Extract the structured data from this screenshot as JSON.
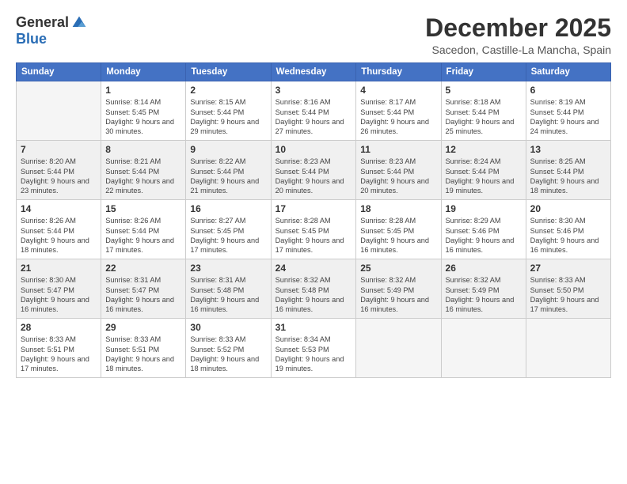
{
  "logo": {
    "general": "General",
    "blue": "Blue"
  },
  "title": "December 2025",
  "location": "Sacedon, Castille-La Mancha, Spain",
  "days_of_week": [
    "Sunday",
    "Monday",
    "Tuesday",
    "Wednesday",
    "Thursday",
    "Friday",
    "Saturday"
  ],
  "weeks": [
    [
      {
        "day": "",
        "sunrise": "",
        "sunset": "",
        "daylight": "",
        "empty": true
      },
      {
        "day": "1",
        "sunrise": "Sunrise: 8:14 AM",
        "sunset": "Sunset: 5:45 PM",
        "daylight": "Daylight: 9 hours and 30 minutes."
      },
      {
        "day": "2",
        "sunrise": "Sunrise: 8:15 AM",
        "sunset": "Sunset: 5:44 PM",
        "daylight": "Daylight: 9 hours and 29 minutes."
      },
      {
        "day": "3",
        "sunrise": "Sunrise: 8:16 AM",
        "sunset": "Sunset: 5:44 PM",
        "daylight": "Daylight: 9 hours and 27 minutes."
      },
      {
        "day": "4",
        "sunrise": "Sunrise: 8:17 AM",
        "sunset": "Sunset: 5:44 PM",
        "daylight": "Daylight: 9 hours and 26 minutes."
      },
      {
        "day": "5",
        "sunrise": "Sunrise: 8:18 AM",
        "sunset": "Sunset: 5:44 PM",
        "daylight": "Daylight: 9 hours and 25 minutes."
      },
      {
        "day": "6",
        "sunrise": "Sunrise: 8:19 AM",
        "sunset": "Sunset: 5:44 PM",
        "daylight": "Daylight: 9 hours and 24 minutes."
      }
    ],
    [
      {
        "day": "7",
        "sunrise": "Sunrise: 8:20 AM",
        "sunset": "Sunset: 5:44 PM",
        "daylight": "Daylight: 9 hours and 23 minutes."
      },
      {
        "day": "8",
        "sunrise": "Sunrise: 8:21 AM",
        "sunset": "Sunset: 5:44 PM",
        "daylight": "Daylight: 9 hours and 22 minutes."
      },
      {
        "day": "9",
        "sunrise": "Sunrise: 8:22 AM",
        "sunset": "Sunset: 5:44 PM",
        "daylight": "Daylight: 9 hours and 21 minutes."
      },
      {
        "day": "10",
        "sunrise": "Sunrise: 8:23 AM",
        "sunset": "Sunset: 5:44 PM",
        "daylight": "Daylight: 9 hours and 20 minutes."
      },
      {
        "day": "11",
        "sunrise": "Sunrise: 8:23 AM",
        "sunset": "Sunset: 5:44 PM",
        "daylight": "Daylight: 9 hours and 20 minutes."
      },
      {
        "day": "12",
        "sunrise": "Sunrise: 8:24 AM",
        "sunset": "Sunset: 5:44 PM",
        "daylight": "Daylight: 9 hours and 19 minutes."
      },
      {
        "day": "13",
        "sunrise": "Sunrise: 8:25 AM",
        "sunset": "Sunset: 5:44 PM",
        "daylight": "Daylight: 9 hours and 18 minutes."
      }
    ],
    [
      {
        "day": "14",
        "sunrise": "Sunrise: 8:26 AM",
        "sunset": "Sunset: 5:44 PM",
        "daylight": "Daylight: 9 hours and 18 minutes."
      },
      {
        "day": "15",
        "sunrise": "Sunrise: 8:26 AM",
        "sunset": "Sunset: 5:44 PM",
        "daylight": "Daylight: 9 hours and 17 minutes."
      },
      {
        "day": "16",
        "sunrise": "Sunrise: 8:27 AM",
        "sunset": "Sunset: 5:45 PM",
        "daylight": "Daylight: 9 hours and 17 minutes."
      },
      {
        "day": "17",
        "sunrise": "Sunrise: 8:28 AM",
        "sunset": "Sunset: 5:45 PM",
        "daylight": "Daylight: 9 hours and 17 minutes."
      },
      {
        "day": "18",
        "sunrise": "Sunrise: 8:28 AM",
        "sunset": "Sunset: 5:45 PM",
        "daylight": "Daylight: 9 hours and 16 minutes."
      },
      {
        "day": "19",
        "sunrise": "Sunrise: 8:29 AM",
        "sunset": "Sunset: 5:46 PM",
        "daylight": "Daylight: 9 hours and 16 minutes."
      },
      {
        "day": "20",
        "sunrise": "Sunrise: 8:30 AM",
        "sunset": "Sunset: 5:46 PM",
        "daylight": "Daylight: 9 hours and 16 minutes."
      }
    ],
    [
      {
        "day": "21",
        "sunrise": "Sunrise: 8:30 AM",
        "sunset": "Sunset: 5:47 PM",
        "daylight": "Daylight: 9 hours and 16 minutes."
      },
      {
        "day": "22",
        "sunrise": "Sunrise: 8:31 AM",
        "sunset": "Sunset: 5:47 PM",
        "daylight": "Daylight: 9 hours and 16 minutes."
      },
      {
        "day": "23",
        "sunrise": "Sunrise: 8:31 AM",
        "sunset": "Sunset: 5:48 PM",
        "daylight": "Daylight: 9 hours and 16 minutes."
      },
      {
        "day": "24",
        "sunrise": "Sunrise: 8:32 AM",
        "sunset": "Sunset: 5:48 PM",
        "daylight": "Daylight: 9 hours and 16 minutes."
      },
      {
        "day": "25",
        "sunrise": "Sunrise: 8:32 AM",
        "sunset": "Sunset: 5:49 PM",
        "daylight": "Daylight: 9 hours and 16 minutes."
      },
      {
        "day": "26",
        "sunrise": "Sunrise: 8:32 AM",
        "sunset": "Sunset: 5:49 PM",
        "daylight": "Daylight: 9 hours and 16 minutes."
      },
      {
        "day": "27",
        "sunrise": "Sunrise: 8:33 AM",
        "sunset": "Sunset: 5:50 PM",
        "daylight": "Daylight: 9 hours and 17 minutes."
      }
    ],
    [
      {
        "day": "28",
        "sunrise": "Sunrise: 8:33 AM",
        "sunset": "Sunset: 5:51 PM",
        "daylight": "Daylight: 9 hours and 17 minutes."
      },
      {
        "day": "29",
        "sunrise": "Sunrise: 8:33 AM",
        "sunset": "Sunset: 5:51 PM",
        "daylight": "Daylight: 9 hours and 18 minutes."
      },
      {
        "day": "30",
        "sunrise": "Sunrise: 8:33 AM",
        "sunset": "Sunset: 5:52 PM",
        "daylight": "Daylight: 9 hours and 18 minutes."
      },
      {
        "day": "31",
        "sunrise": "Sunrise: 8:34 AM",
        "sunset": "Sunset: 5:53 PM",
        "daylight": "Daylight: 9 hours and 19 minutes."
      },
      {
        "day": "",
        "sunrise": "",
        "sunset": "",
        "daylight": "",
        "empty": true
      },
      {
        "day": "",
        "sunrise": "",
        "sunset": "",
        "daylight": "",
        "empty": true
      },
      {
        "day": "",
        "sunrise": "",
        "sunset": "",
        "daylight": "",
        "empty": true
      }
    ]
  ]
}
